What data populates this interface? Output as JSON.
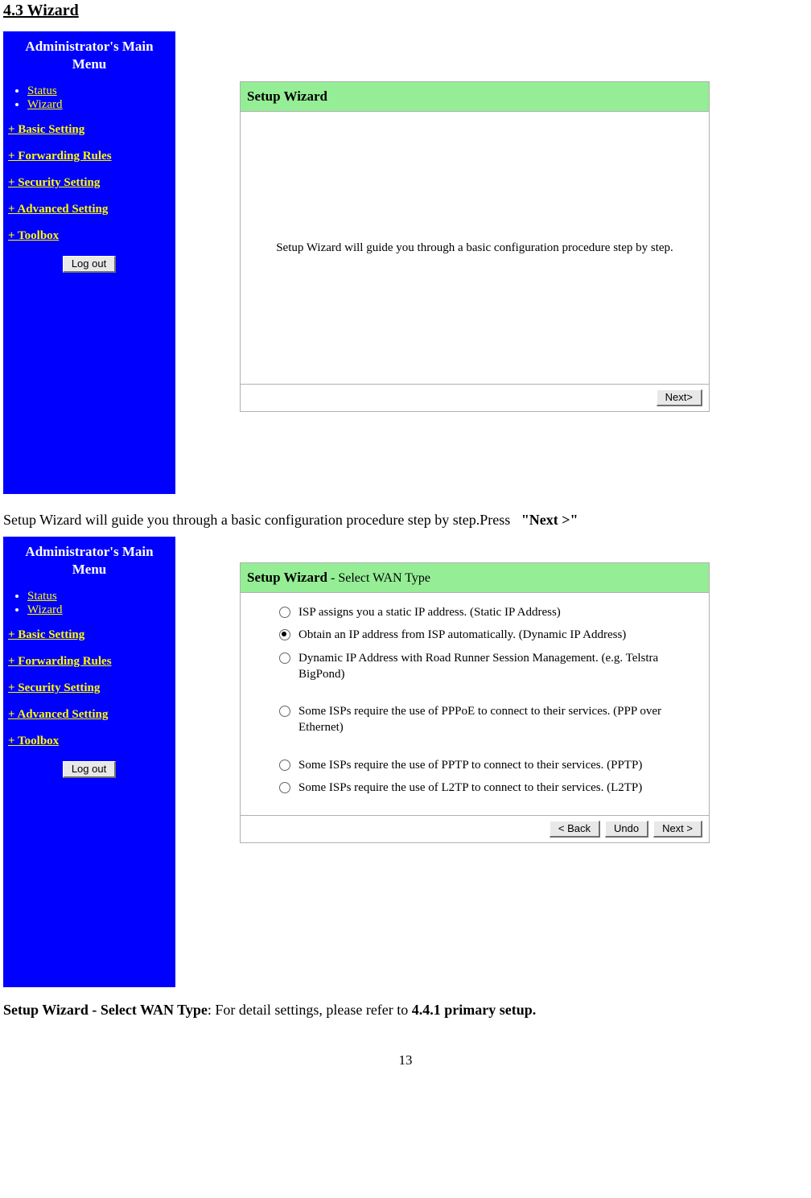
{
  "page_heading": "4.3 Wizard",
  "sidebar": {
    "title_line1": "Administrator's Main",
    "title_line2": "Menu",
    "bullets": {
      "status": "Status",
      "wizard": "Wizard"
    },
    "collapsibles": {
      "basic": "+ Basic Setting",
      "forwarding": "+ Forwarding Rules",
      "security": "+ Security Setting",
      "advanced": "+ Advanced Setting",
      "toolbox": "+ Toolbox"
    },
    "logout": "Log out"
  },
  "panel1": {
    "title": "Setup Wizard",
    "body": "Setup Wizard will guide you through a basic configuration procedure step by step.",
    "next": "Next>"
  },
  "mid_text_a": "Setup Wizard will guide you through a basic configuration procedure step by step.Press",
  "mid_text_b": "\"Next >\"",
  "panel2": {
    "title_strong": "Setup Wizard",
    "title_sub": " - Select WAN Type",
    "options": {
      "o1": "ISP assigns you a static IP address. (Static IP Address)",
      "o2": "Obtain an IP address from ISP automatically. (Dynamic IP Address)",
      "o3": "Dynamic IP Address with Road Runner Session Management. (e.g. Telstra BigPond)",
      "o4": "Some ISPs require the use of PPPoE to connect to their services. (PPP over Ethernet)",
      "o5": "Some ISPs require the use of PPTP to connect to their services. (PPTP)",
      "o6": "Some ISPs require the use of L2TP to connect to their services. (L2TP)"
    },
    "back": "< Back",
    "undo": "Undo",
    "next": "Next >"
  },
  "bottom_text_a": "Setup Wizard - Select WAN Type",
  "bottom_text_b": ": For detail settings, please refer to ",
  "bottom_text_c": "4.4.1 primary setup.",
  "page_number": "13"
}
